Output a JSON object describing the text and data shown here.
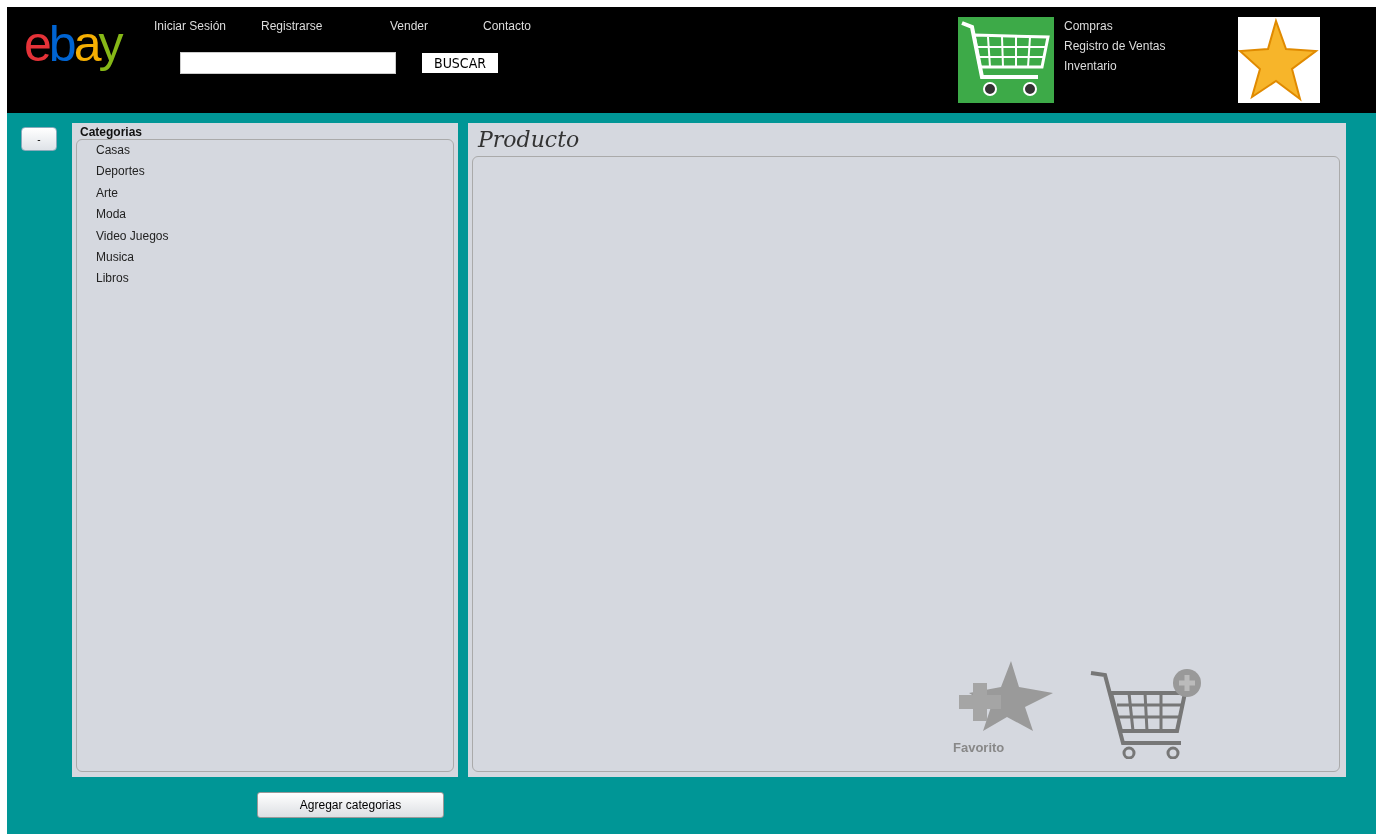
{
  "header": {
    "logo": "ebay",
    "nav": [
      "Iniciar Sesión",
      "Registrarse",
      "Vender",
      "Contacto"
    ],
    "search_button": "BUSCAR",
    "menu": [
      "Compras",
      "Registro de Ventas",
      "Inventario"
    ]
  },
  "collapse_button": "-",
  "categories": {
    "title": "Categorias",
    "items": [
      "Casas",
      "Deportes",
      "Arte",
      "Moda",
      "Video Juegos",
      "Musica",
      "Libros"
    ]
  },
  "product": {
    "title": "Producto",
    "favorite_label": "Favorito"
  },
  "add_categories_button": "Agregar categorias"
}
